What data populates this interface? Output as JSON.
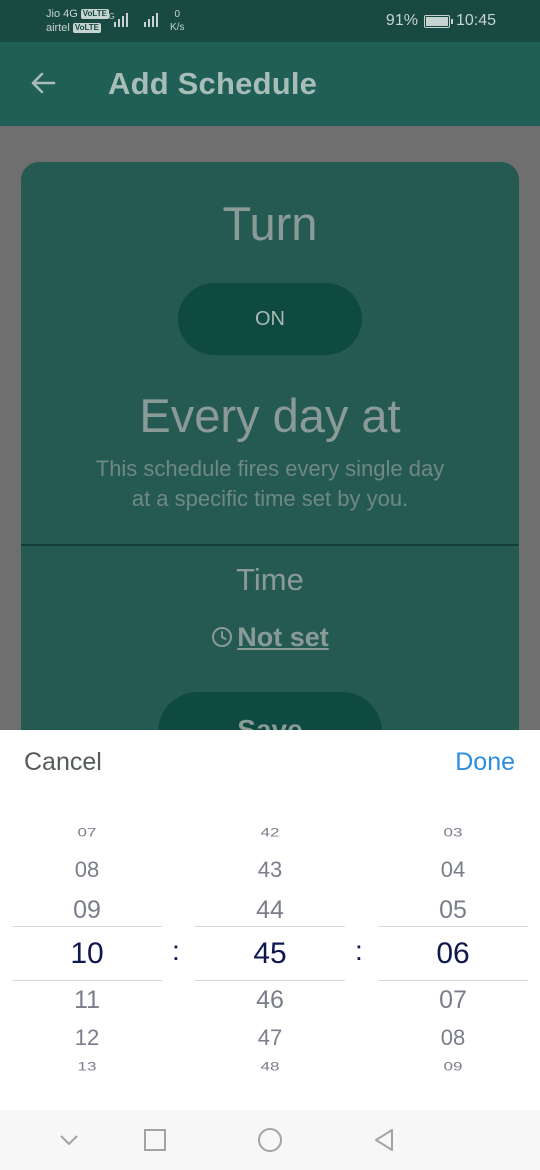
{
  "status_bar": {
    "carrier1": "Jio 4G",
    "carrier2": "airtel",
    "volte": "VoLTE",
    "network": "4G",
    "speed_value": "0",
    "speed_unit": "K/s",
    "battery": "91%",
    "time": "10:45"
  },
  "app_bar": {
    "back_icon": "arrow-left-icon",
    "title": "Add Schedule"
  },
  "card": {
    "turn_label": "Turn",
    "toggle_label": "ON",
    "schedule_title": "Every day at",
    "schedule_desc_line1": "This schedule fires every single day",
    "schedule_desc_line2": "at a specific time set by you.",
    "time_label": "Time",
    "time_value": "Not set",
    "time_icon": "clock-icon",
    "save_label": "Save"
  },
  "picker": {
    "cancel_label": "Cancel",
    "done_label": "Done",
    "separator": ":",
    "hours": [
      "07",
      "08",
      "09",
      "10",
      "11",
      "12",
      "13"
    ],
    "minutes": [
      "42",
      "43",
      "44",
      "45",
      "46",
      "47",
      "48"
    ],
    "seconds": [
      "03",
      "04",
      "05",
      "06",
      "07",
      "08",
      "09"
    ],
    "selected": {
      "hour": "10",
      "minute": "45",
      "second": "06"
    }
  },
  "nav_bar": {
    "icons": [
      "chevron-down-icon",
      "recents-square-icon",
      "home-circle-icon",
      "back-triangle-icon"
    ]
  },
  "colors": {
    "accent": "#2b8fde",
    "app_bar": "#205f56",
    "selected_text": "#0e1750"
  }
}
